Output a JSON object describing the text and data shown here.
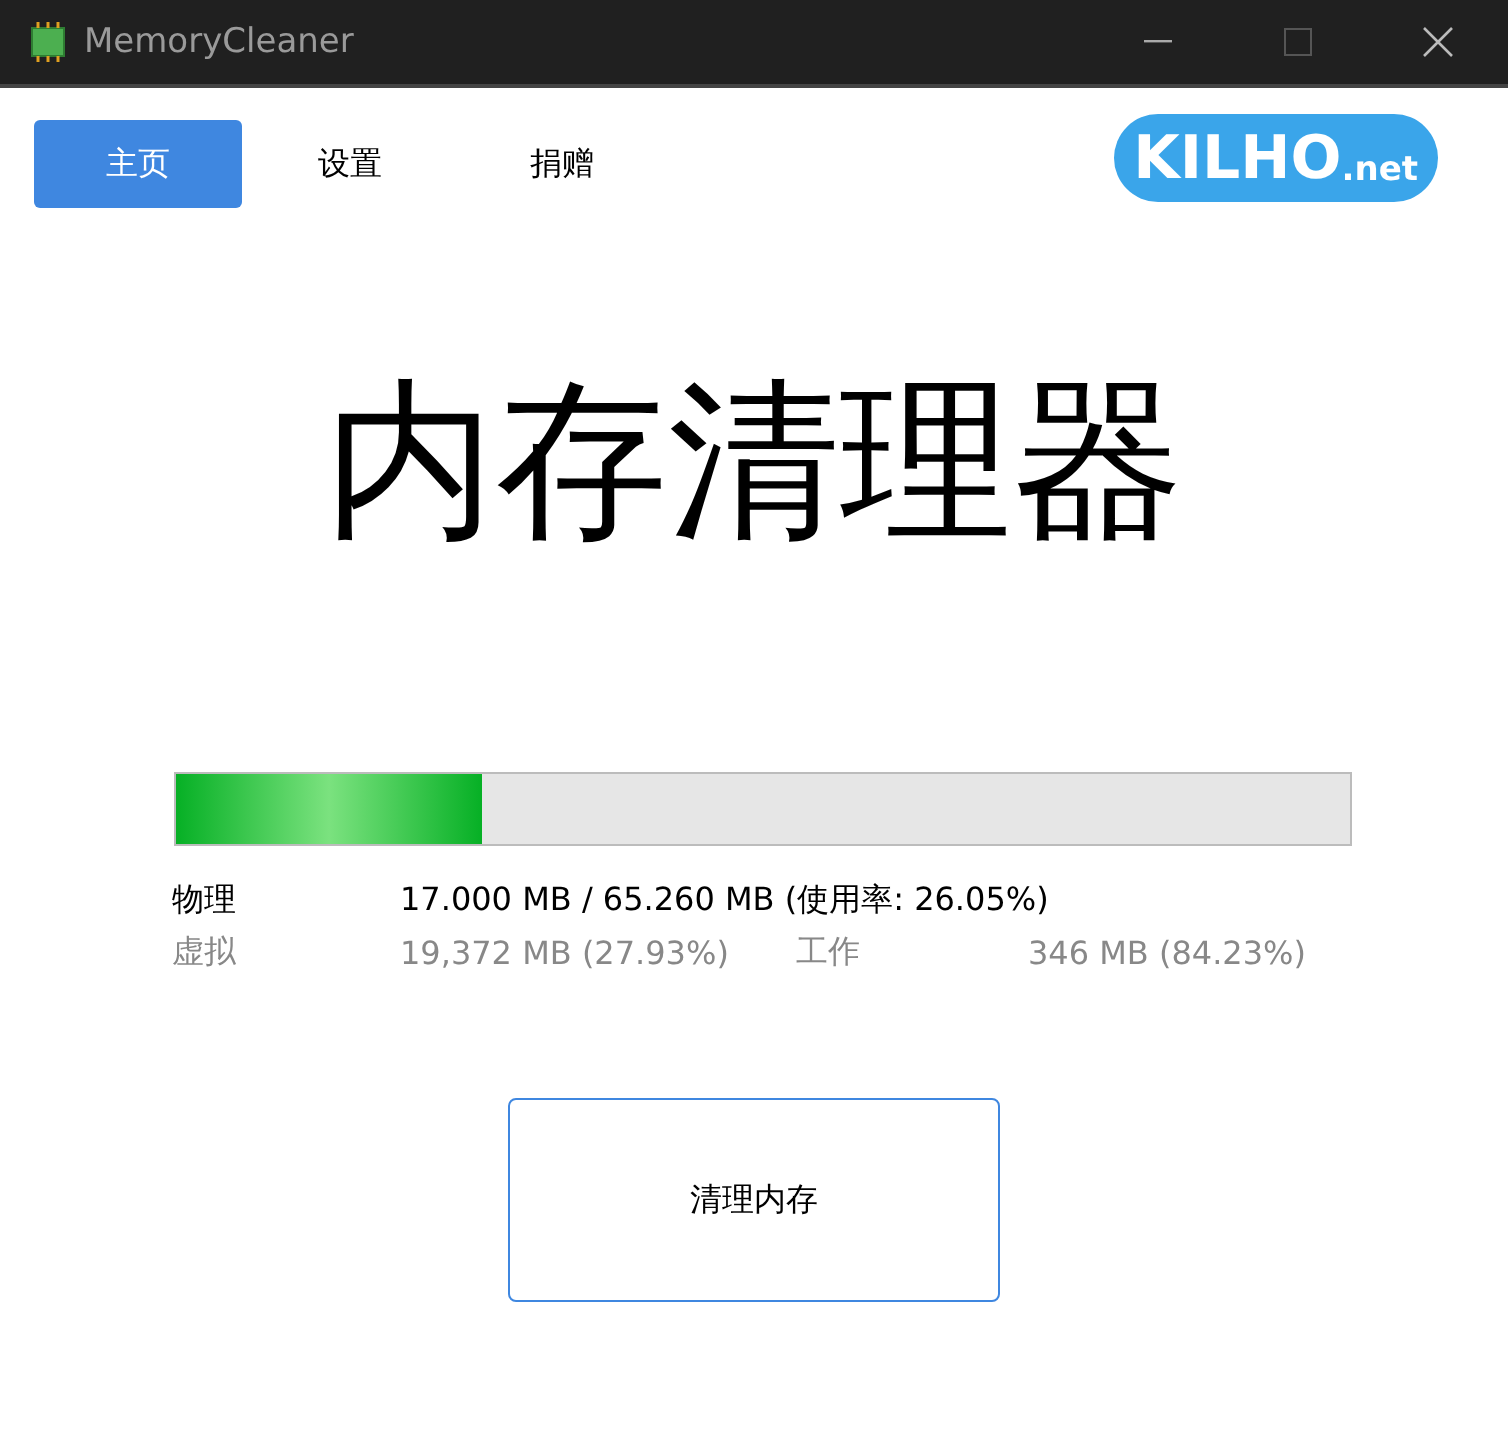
{
  "window": {
    "title": "MemoryCleaner"
  },
  "tabs": [
    {
      "label": "主页",
      "selected": true
    },
    {
      "label": "设置",
      "selected": false
    },
    {
      "label": "捐赠",
      "selected": false
    }
  ],
  "logo": {
    "name": "KILHO",
    "suffix": ".net"
  },
  "heading": "内存清理器",
  "memory_bar": {
    "level": 0.2605
  },
  "stats": [
    {
      "label": "物理",
      "value": "17.000 MB / 65.260 MB (使用率: 26.05%)",
      "dimmed": false
    },
    {
      "label": "虚拟",
      "value": "19,372 MB (27.93%)",
      "label_2": "工作",
      "value_2": "346 MB (84.23%)",
      "dimmed": true
    }
  ],
  "clean_button": "清理内存"
}
